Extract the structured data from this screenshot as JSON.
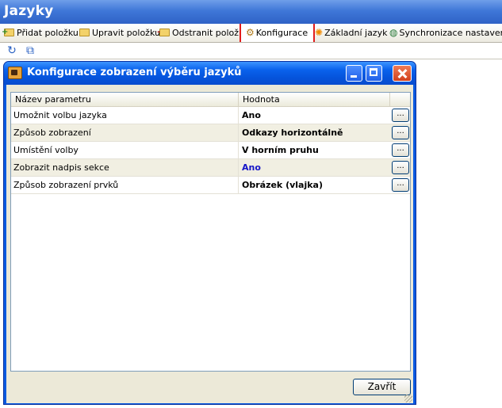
{
  "app": {
    "title": "Jazyky"
  },
  "toolbar": {
    "add_label": "Přidat položku",
    "edit_label": "Upravit položku",
    "remove_label": "Odstranit položku",
    "config_label": "Konfigurace",
    "base_language_label": "Základní jazyk",
    "sync_label": "Synchronizace nastavení"
  },
  "toolbar2": {
    "refresh_icon": "refresh-icon",
    "copy_icon": "copy-icon"
  },
  "dialog": {
    "title": "Konfigurace zobrazení výběru jazyků",
    "columns": [
      "Název parametru",
      "Hodnota"
    ],
    "rows": [
      {
        "name": "Umožnit volbu jazyka",
        "value": "Ano",
        "button": "..."
      },
      {
        "name": "Způsob zobrazení",
        "value": "Odkazy horizontálně",
        "button": "..."
      },
      {
        "name": "Umístění volby",
        "value": "V horním pruhu",
        "button": "..."
      },
      {
        "name": "Zobrazit nadpis sekce",
        "value": "Ano",
        "button": "..."
      },
      {
        "name": "Způsob zobrazení prvků",
        "value": "Obrázek (vlajka)",
        "button": "..."
      }
    ],
    "close_label": "Zavřít"
  },
  "colors": {
    "title_bar": "#3f77d8",
    "dialog_frame": "#0a5ae0",
    "highlight_border": "#e21c1c",
    "value_blue": "#1515c8"
  }
}
